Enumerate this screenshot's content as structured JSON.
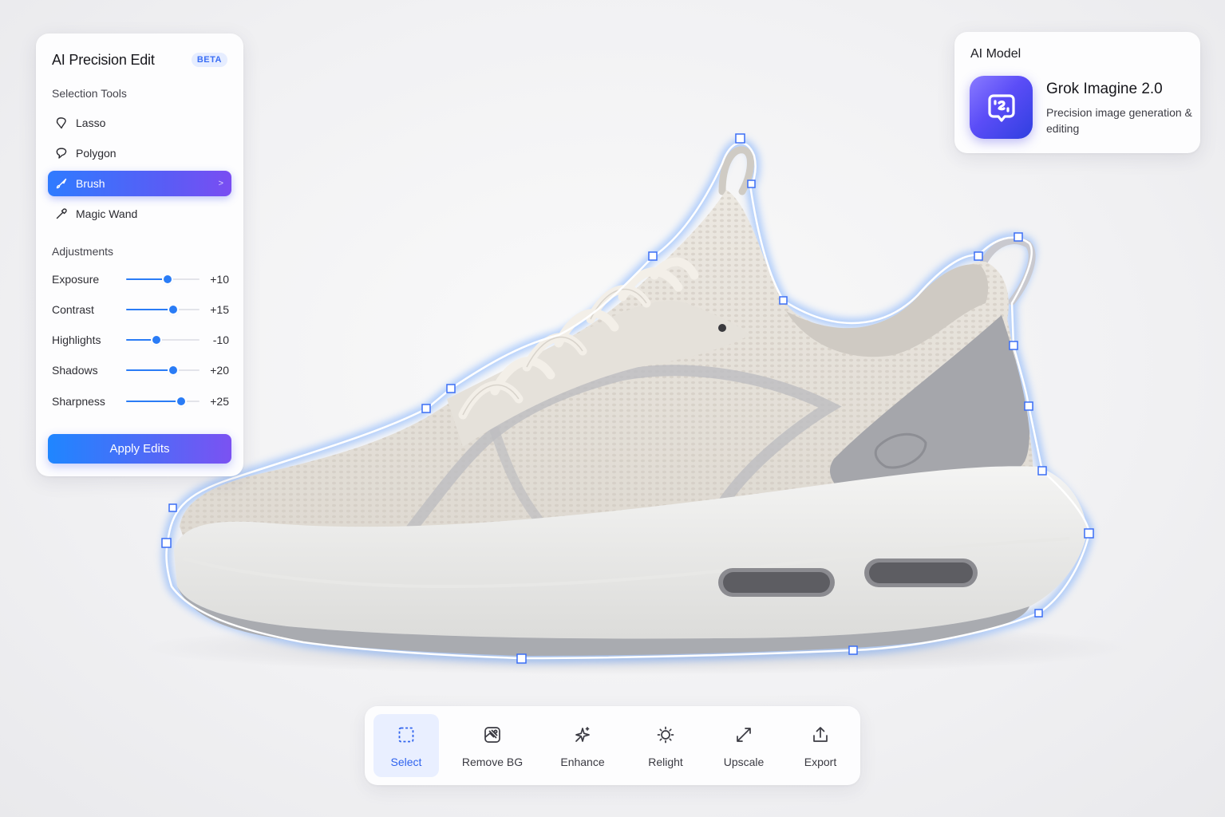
{
  "panel": {
    "title": "AI Precision Edit",
    "badge": "BETA",
    "selection_heading": "Selection Tools",
    "tools": [
      {
        "label": "Lasso",
        "icon": "lasso-icon",
        "active": false
      },
      {
        "label": "Polygon",
        "icon": "polygon-icon",
        "active": false
      },
      {
        "label": "Brush",
        "icon": "brush-icon",
        "active": true
      },
      {
        "label": "Magic Wand",
        "icon": "magic-wand-icon",
        "active": false
      }
    ],
    "adjustments_heading": "Adjustments",
    "adjustments": [
      {
        "label": "Exposure",
        "value": "+10",
        "level": 0.57
      },
      {
        "label": "Contrast",
        "value": "+15",
        "level": 0.64
      },
      {
        "label": "Highlights",
        "value": "-10",
        "level": 0.41
      },
      {
        "label": "Shadows",
        "value": "+20",
        "level": 0.64
      },
      {
        "label": "Sharpness",
        "value": "+25",
        "level": 0.75
      }
    ],
    "apply_label": "Apply Edits"
  },
  "model": {
    "heading": "AI Model",
    "name": "Grok Imagine 2.0",
    "description": "Precision image generation & editing",
    "icon": "ai-model-icon"
  },
  "toolbar": {
    "items": [
      {
        "label": "Select",
        "icon": "select-icon",
        "active": true
      },
      {
        "label": "Remove BG",
        "icon": "remove-bg-icon",
        "active": false
      },
      {
        "label": "Enhance",
        "icon": "enhance-icon",
        "active": false
      },
      {
        "label": "Relight",
        "icon": "relight-icon",
        "active": false
      },
      {
        "label": "Upscale",
        "icon": "upscale-icon",
        "active": false
      },
      {
        "label": "Export",
        "icon": "export-icon",
        "active": false
      }
    ]
  },
  "colors": {
    "accent": "#2a7cf6",
    "accent_purple": "#7b52f2",
    "selection_glow": "#4f8dff"
  }
}
